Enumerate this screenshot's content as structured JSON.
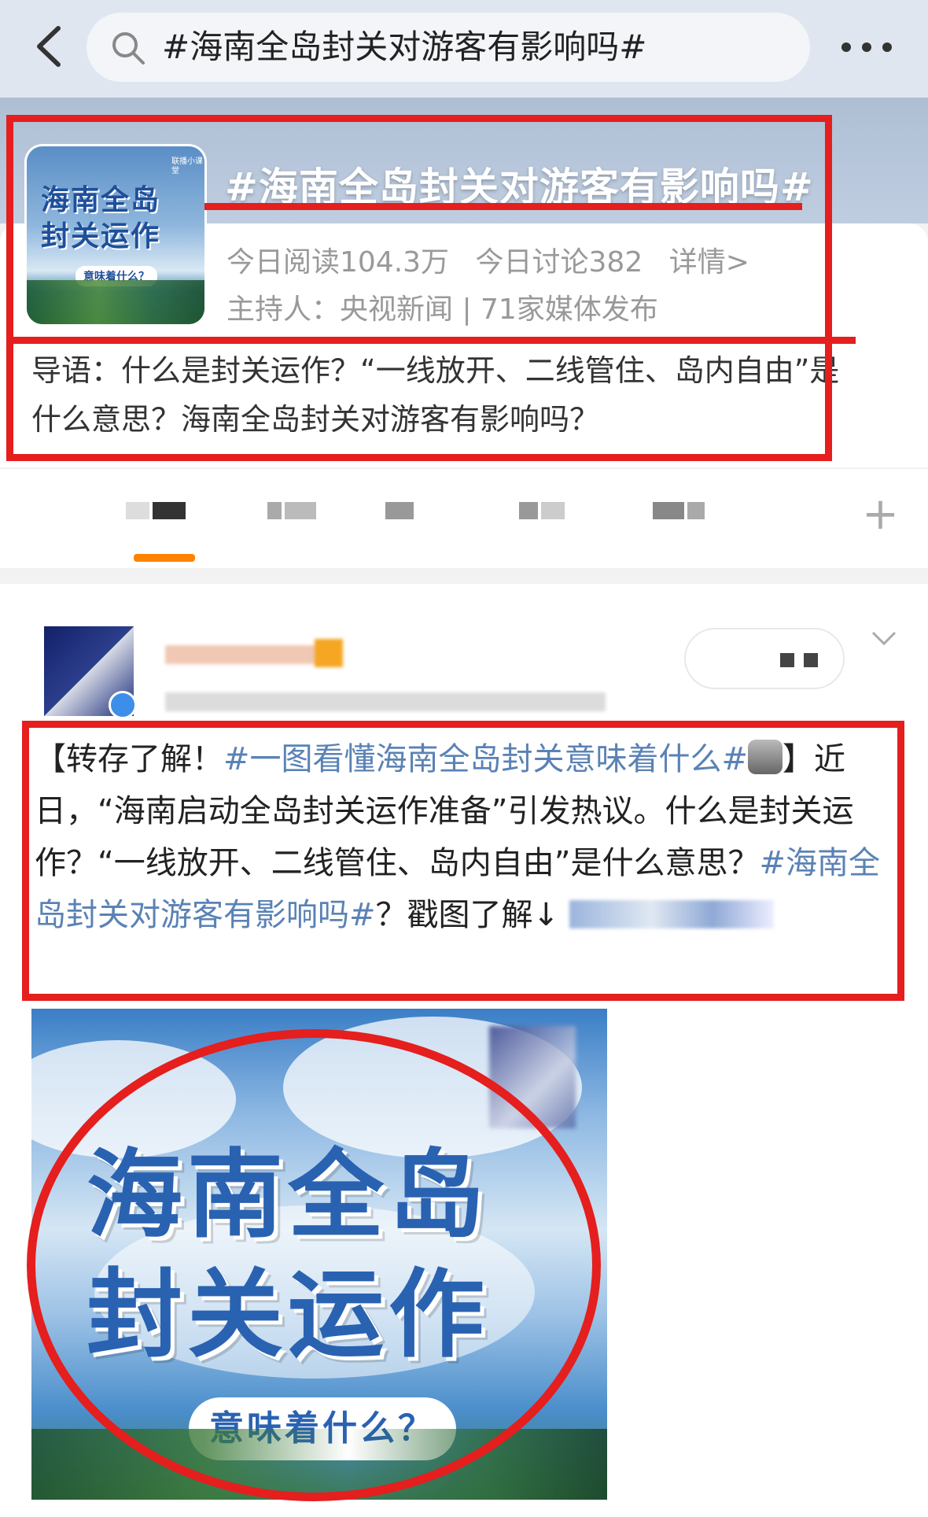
{
  "search": {
    "query": "#海南全岛封关对游客有影响吗#"
  },
  "topic": {
    "title": "#海南全岛封关对游客有影响吗#",
    "read_today": "今日阅读104.3万",
    "discuss_today": "今日讨论382",
    "details_link": "详情>",
    "host": "主持人：央视新闻 | 71家媒体发布",
    "guide": "导语：什么是封关运作？“一线放开、二线管住、岛内自由”是什么意思？海南全岛封关对游客有影响吗？",
    "thumbnail": {
      "line1": "海南全岛",
      "line2": "封关运作",
      "sub": "意味着什么？",
      "tag": "联播小课堂"
    }
  },
  "tabs": {
    "add_icon": "plus-icon"
  },
  "post": {
    "text_part1": "【转存了解！",
    "hashtag1": "#一图看懂海南全岛封关意味着什么#",
    "text_part2": "】近日，“海南启动全岛封关运作准备”引发热议。什么是封关运作？“一线放开、二线管住、岛内自由”是什么意思？",
    "hashtag2": "#海南全岛封关对游客有影响吗#",
    "text_part3": "？戳图了解↓",
    "image": {
      "line1": "海南全岛",
      "line2": "封关运作",
      "sub": "意味着什么？"
    }
  },
  "colors": {
    "accent": "#ff8200",
    "link": "#5a82b5",
    "annotation": "#e51e1e"
  }
}
